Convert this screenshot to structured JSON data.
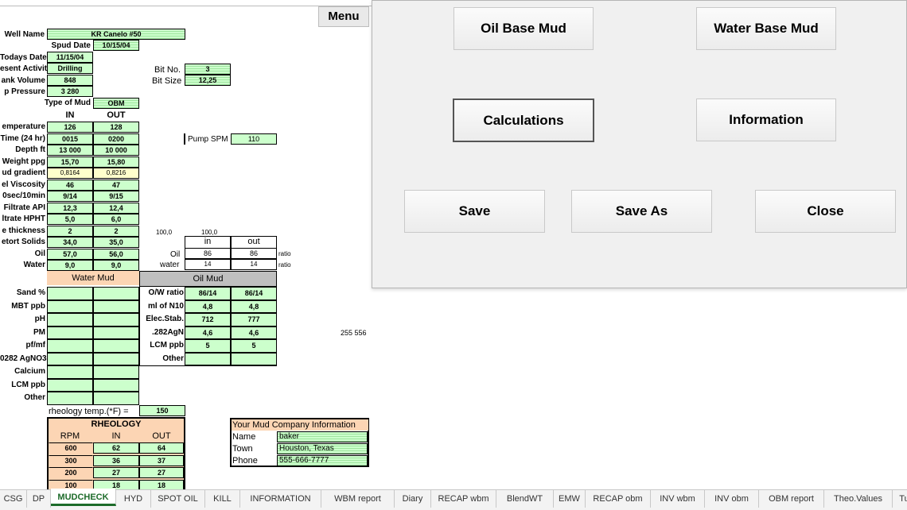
{
  "menu_label": "Menu",
  "header": {
    "well_name_label": "Well  Name",
    "well_name": "KR  Canelo #50",
    "spud_date_label": "Spud Date",
    "spud_date": "10/15/04",
    "todays_date_label": "Todays Date",
    "todays_date": "11/15/04",
    "present_activity_label": "esent Activity",
    "present_activity": "Drilling",
    "tank_volume_label": "ank Volume",
    "tank_volume": "848",
    "pump_pressure_label": "p Pressure",
    "pump_pressure": "3 280",
    "type_of_mud_label": "Type of Mud",
    "type_of_mud": "OBM",
    "bit_no_label": "Bit No.",
    "bit_no": "3",
    "bit_size_label": "Bit Size",
    "bit_size": "12,25",
    "pump_spm_label": "Pump SPM",
    "pump_spm": "110"
  },
  "mudcheck": {
    "col_in": "IN",
    "col_out": "OUT",
    "rows": [
      {
        "label": "emperature",
        "in": "126",
        "out": "128"
      },
      {
        "label": "Time  (24 hr)",
        "in": "0015",
        "out": "0200"
      },
      {
        "label": "Depth  ft",
        "in": "13 000",
        "out": "10 000"
      },
      {
        "label": "Weight  ppg",
        "in": "15,70",
        "out": "15,80"
      },
      {
        "label": "ud gradient",
        "in": "0,8164",
        "out": "0,8216"
      },
      {
        "label": "el Viscosity",
        "in": "46",
        "out": "47"
      },
      {
        "label": "0sec/10min",
        "in": "9/14",
        "out": "9/15"
      },
      {
        "label": "Filtrate  API",
        "in": "12,3",
        "out": "12,4"
      },
      {
        "label": "ltrate  HPHT",
        "in": "5,0",
        "out": "6,0"
      },
      {
        "label": "e thickness",
        "in": "2",
        "out": "2"
      },
      {
        "label": "etort  Solids",
        "in": "34,0",
        "out": "35,0"
      },
      {
        "label": "Oil",
        "in": "57,0",
        "out": "56,0"
      },
      {
        "label": "Water",
        "in": "9,0",
        "out": "9,0"
      }
    ]
  },
  "ratio": {
    "top_a": "100,0",
    "top_b": "100,0",
    "col_in": "in",
    "col_out": "out",
    "oil_label": "Oil",
    "oil_in": "86",
    "oil_out": "86",
    "water_label": "water",
    "water_in": "14",
    "water_out": "14",
    "unit": "ratio"
  },
  "water_mud": {
    "title": "Water  Mud",
    "labels": [
      "Sand  %",
      "MBT  ppb",
      "pH",
      "PM",
      "pf/mf",
      "0282 AgNO3",
      "Calcium",
      "LCM  ppb",
      "Other"
    ]
  },
  "oil_mud": {
    "title": "Oil Mud",
    "rows": [
      {
        "label": "O/W ratio",
        "in": "86/14",
        "out": "86/14"
      },
      {
        "label": "ml of N10",
        "in": "4,8",
        "out": "4,8"
      },
      {
        "label": "Elec.Stab.",
        "in": "712",
        "out": "777"
      },
      {
        "label": ".282AgN",
        "in": "4,6",
        "out": "4,6"
      },
      {
        "label": "LCM ppb",
        "in": "5",
        "out": "5"
      },
      {
        "label": "Other",
        "in": "",
        "out": ""
      }
    ]
  },
  "stray_value": "255 556",
  "rheology": {
    "temp_label": "rheology   temp.(*F) =",
    "temp": "150",
    "title": "RHEOLOGY",
    "col_rpm": "RPM",
    "col_in": "IN",
    "col_out": "OUT",
    "rows": [
      {
        "rpm": "600",
        "in": "62",
        "out": "64"
      },
      {
        "rpm": "300",
        "in": "36",
        "out": "37"
      },
      {
        "rpm": "200",
        "in": "27",
        "out": "27"
      },
      {
        "rpm": "100",
        "in": "18",
        "out": "18"
      }
    ]
  },
  "company": {
    "title": "Your Mud Company  Information",
    "name_label": "Name",
    "name": "baker",
    "town_label": "Town",
    "town": "Houston, Texas",
    "phone_label": "Phone",
    "phone": "555-666-7777"
  },
  "menu_panel": {
    "oil_base": "Oil Base Mud",
    "water_base": "Water Base Mud",
    "calculations": "Calculations",
    "information": "Information",
    "save": "Save",
    "save_as": "Save As",
    "close": "Close"
  },
  "sheet_tabs": [
    "CSG",
    "DP",
    "MUDCHECK",
    "HYD",
    "SPOT OIL",
    "KILL",
    "INFORMATION",
    "WBM report",
    "Diary",
    "RECAP wbm",
    "BlendWT",
    "EMW",
    "RECAP obm",
    "INV wbm",
    "INV obm",
    "OBM report",
    "Theo.Values",
    "Tu"
  ],
  "active_tab": "MUDCHECK"
}
